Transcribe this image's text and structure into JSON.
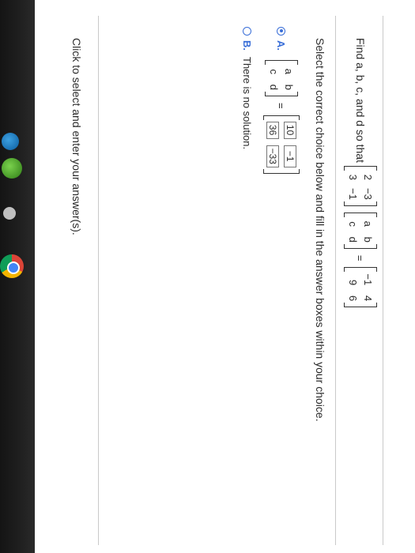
{
  "question": {
    "prompt": "Find a, b, c, and d so that",
    "left_matrix": [
      [
        "2",
        "−3"
      ],
      [
        "3",
        "−1"
      ]
    ],
    "var_matrix": [
      [
        "a",
        "b"
      ],
      [
        "c",
        "d"
      ]
    ],
    "equals": "=",
    "result_matrix": [
      [
        "−1",
        "4"
      ],
      [
        "9",
        "6"
      ]
    ]
  },
  "instruction": "Select the correct choice below and fill in the answer boxes within your choice.",
  "choices": [
    {
      "letter": "A.",
      "selected": true,
      "var_matrix": [
        [
          "a",
          "b"
        ],
        [
          "c",
          "d"
        ]
      ],
      "equals": "=",
      "answers": [
        [
          "10",
          "−1"
        ],
        [
          "36",
          "−33"
        ]
      ]
    },
    {
      "letter": "B.",
      "selected": false,
      "text": "There is no solution."
    }
  ],
  "footer": "Click to select and enter your answer(s)."
}
